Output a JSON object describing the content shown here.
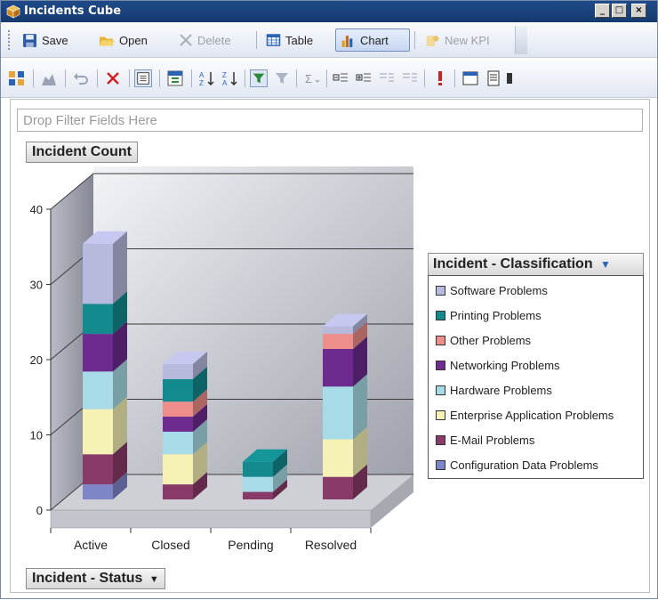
{
  "window": {
    "title": "Incidents Cube",
    "controls": [
      "_",
      "□",
      "×"
    ]
  },
  "toolbar1": {
    "save": "Save",
    "open": "Open",
    "delete": "Delete",
    "table": "Table",
    "chart": "Chart",
    "new_kpi": "New KPI"
  },
  "filter_placeholder": "Drop Filter Fields Here",
  "measure_label": "Incident Count",
  "row_field": "Incident - Status",
  "legend": {
    "title": "Incident - Classification",
    "items": [
      {
        "label": "Software Problems",
        "color": "#b7b9dd"
      },
      {
        "label": "Printing Problems",
        "color": "#128a8e"
      },
      {
        "label": "Other Problems",
        "color": "#ee8e8a"
      },
      {
        "label": "Networking Problems",
        "color": "#6d2a8f"
      },
      {
        "label": "Hardware Problems",
        "color": "#a7dbe7"
      },
      {
        "label": "Enterprise Application Problems",
        "color": "#f6f2b5"
      },
      {
        "label": "E-Mail Problems",
        "color": "#8a3a68"
      },
      {
        "label": "Configuration Data Problems",
        "color": "#7f85c9"
      }
    ]
  },
  "chart_data": {
    "type": "bar",
    "stacked": true,
    "categories": [
      "Active",
      "Closed",
      "Pending",
      "Resolved"
    ],
    "ylabel": "Incident Count",
    "xlabel": "Incident - Status",
    "ylim": [
      0,
      40
    ],
    "yticks": [
      0,
      10,
      20,
      30,
      40
    ],
    "series": [
      {
        "name": "Configuration Data Problems",
        "values": [
          2,
          0,
          0,
          0
        ]
      },
      {
        "name": "E-Mail Problems",
        "values": [
          4,
          2,
          1,
          3
        ]
      },
      {
        "name": "Enterprise Application Problems",
        "values": [
          6,
          4,
          0,
          5
        ]
      },
      {
        "name": "Hardware Problems",
        "values": [
          5,
          3,
          2,
          7
        ]
      },
      {
        "name": "Networking Problems",
        "values": [
          5,
          2,
          0,
          5
        ]
      },
      {
        "name": "Other Problems",
        "values": [
          0,
          2,
          0,
          2
        ]
      },
      {
        "name": "Printing Problems",
        "values": [
          4,
          3,
          2,
          0
        ]
      },
      {
        "name": "Software Problems",
        "values": [
          8,
          2,
          0,
          1
        ]
      }
    ]
  }
}
